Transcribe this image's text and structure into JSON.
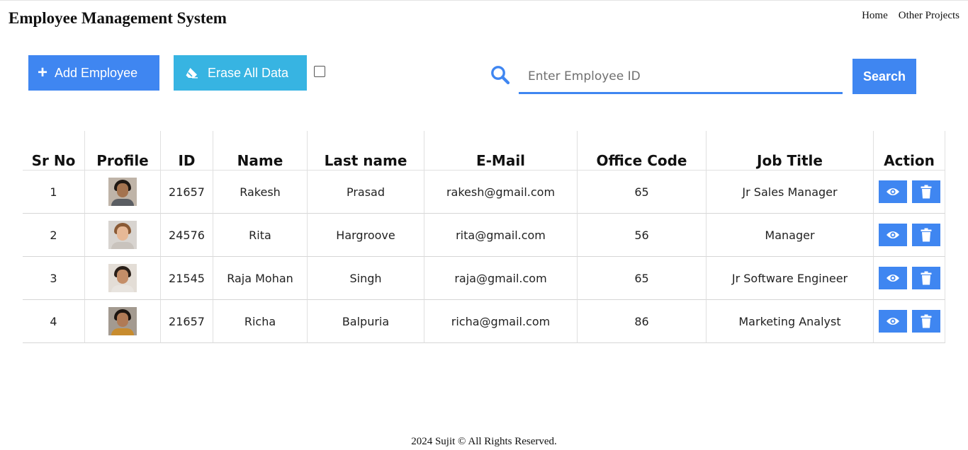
{
  "header": {
    "title": "Employee Management System",
    "nav": [
      {
        "label": "Home"
      },
      {
        "label": "Other Projects"
      }
    ]
  },
  "toolbar": {
    "add_label": "Add Employee",
    "erase_label": "Erase All Data",
    "erase_checkbox_checked": false,
    "search_value": "",
    "search_placeholder": "Enter Employee ID",
    "search_button_label": "Search"
  },
  "table": {
    "columns": [
      "Sr No",
      "Profile",
      "ID",
      "Name",
      "Last name",
      "E-Mail",
      "Office Code",
      "Job Title",
      "Action"
    ],
    "rows": [
      {
        "sr": "1",
        "id": "21657",
        "name": "Rakesh",
        "last_name": "Prasad",
        "email": "rakesh@gmail.com",
        "office_code": "65",
        "job_title": "Jr Sales Manager",
        "avatar": {
          "bg": "#bfb4a8",
          "hair": "#1f1813",
          "skin": "#a4734f",
          "cloth": "#5a5d62"
        }
      },
      {
        "sr": "2",
        "id": "24576",
        "name": "Rita",
        "last_name": "Hargroove",
        "email": "rita@gmail.com",
        "office_code": "56",
        "job_title": "Manager",
        "avatar": {
          "bg": "#d8d4d0",
          "hair": "#8a5a35",
          "skin": "#e6b896",
          "cloth": "#c9c3bd"
        }
      },
      {
        "sr": "3",
        "id": "21545",
        "name": "Raja Mohan",
        "last_name": "Singh",
        "email": "raja@gmail.com",
        "office_code": "65",
        "job_title": "Jr Software Engineer",
        "avatar": {
          "bg": "#e3ddd6",
          "hair": "#2a1f18",
          "skin": "#c48e68",
          "cloth": "#e8e4df"
        }
      },
      {
        "sr": "4",
        "id": "21657",
        "name": "Richa",
        "last_name": "Balpuria",
        "email": "richa@gmail.com",
        "office_code": "86",
        "job_title": "Marketing Analyst",
        "avatar": {
          "bg": "#a39a90",
          "hair": "#1c1510",
          "skin": "#b07a55",
          "cloth": "#c88c2e"
        }
      }
    ]
  },
  "footer": {
    "text": "2024 Sujit © All Rights Reserved."
  },
  "colors": {
    "primary": "#3f86f1",
    "erase": "#37b4e2"
  },
  "icons": {
    "add": "plus-icon",
    "erase": "eraser-icon",
    "search": "search-icon",
    "view": "eye-icon",
    "delete": "trash-icon"
  }
}
